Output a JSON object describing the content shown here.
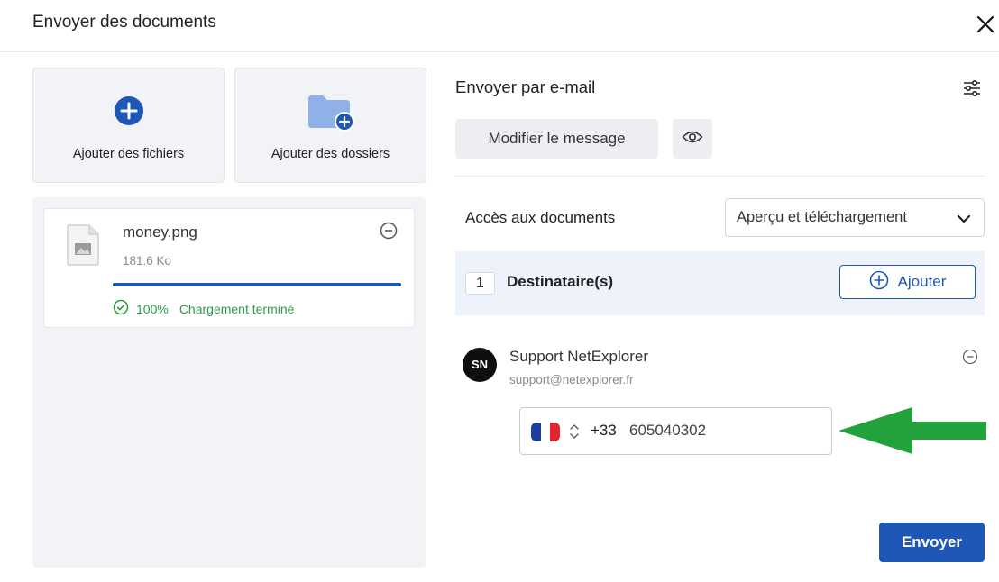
{
  "header": {
    "title": "Envoyer des documents",
    "close_icon": "close-icon"
  },
  "upload": {
    "add_files_label": "Ajouter des fichiers",
    "add_folders_label": "Ajouter des dossiers",
    "add_files_icon": "plus-circle-icon",
    "add_folders_icon": "folder-plus-icon"
  },
  "files": [
    {
      "name": "money.png",
      "size": "181.6 Ko",
      "progress_percent": 100,
      "progress_text": "100%",
      "status": "Chargement terminé",
      "icon": "image-file-icon",
      "status_icon": "check-circle-icon"
    }
  ],
  "email": {
    "title": "Envoyer par e-mail",
    "edit_message_label": "Modifier le message",
    "preview_icon": "eye-icon",
    "settings_icon": "sliders-icon"
  },
  "access": {
    "label": "Accès aux documents",
    "selected": "Aperçu et téléchargement"
  },
  "recipients": {
    "count": "1",
    "label": "Destinataire(s)",
    "add_label": "Ajouter",
    "items": [
      {
        "initials": "SN",
        "name": "Support NetExplorer",
        "email": "support@netexplorer.fr",
        "phone": {
          "country": "FR",
          "dial_code": "+33",
          "number": "605040302"
        }
      }
    ]
  },
  "actions": {
    "send_label": "Envoyer"
  },
  "colors": {
    "accent": "#1f57b8",
    "success": "#2e9b44",
    "annotation_arrow": "#22a23c"
  }
}
